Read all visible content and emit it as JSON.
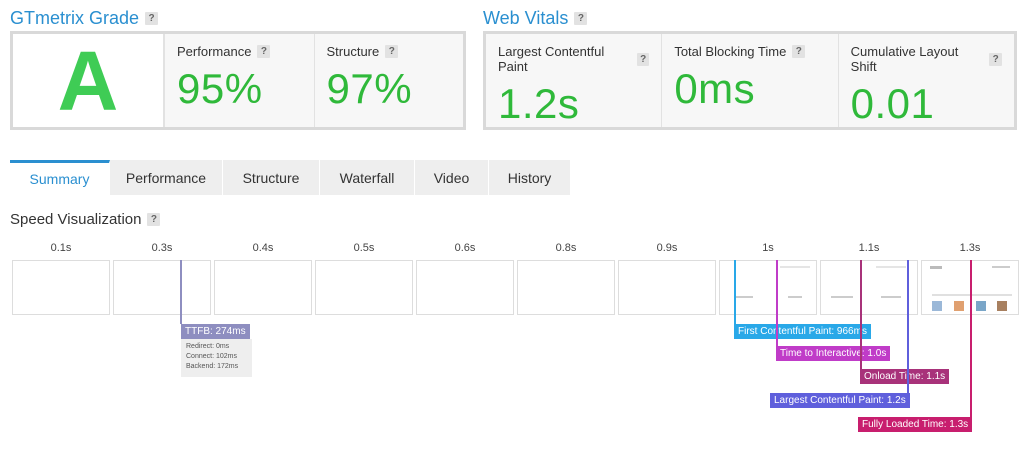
{
  "grade_section": {
    "title": "GTmetrix Grade",
    "help": "?",
    "grade": "A",
    "performance": {
      "label": "Performance",
      "value": "95%"
    },
    "structure": {
      "label": "Structure",
      "value": "97%"
    }
  },
  "vitals_section": {
    "title": "Web Vitals",
    "help": "?",
    "metrics": [
      {
        "label": "Largest Contentful Paint",
        "value": "1.2s"
      },
      {
        "label": "Total Blocking Time",
        "value": "0ms"
      },
      {
        "label": "Cumulative Layout Shift",
        "value": "0.01"
      }
    ]
  },
  "tabs": [
    "Summary",
    "Performance",
    "Structure",
    "Waterfall",
    "Video",
    "History"
  ],
  "speed_viz": {
    "title": "Speed Visualization",
    "help": "?",
    "times": [
      "0.1s",
      "0.3s",
      "0.4s",
      "0.5s",
      "0.6s",
      "0.8s",
      "0.9s",
      "1s",
      "1.1s",
      "1.3s"
    ],
    "ttfb": {
      "label": "TTFB: 274ms",
      "redirect": "Redirect: 0ms",
      "connect": "Connect: 102ms",
      "backend": "Backend: 172ms"
    },
    "markers": {
      "fcp": "First Contentful Paint: 966ms",
      "tti": "Time to Interactive: 1.0s",
      "onload": "Onload Time: 1.1s",
      "lcp": "Largest Contentful Paint: 1.2s",
      "fully_loaded": "Fully Loaded Time: 1.3s"
    }
  },
  "colors": {
    "accent": "#2a8fd0",
    "green": "#2fb93a",
    "ttfb": "#8e8ec0",
    "fcp": "#29a8e8",
    "tti": "#c03cc8",
    "onload": "#a8327a",
    "lcp": "#5f5fdc",
    "fully_loaded": "#c81e6e"
  }
}
